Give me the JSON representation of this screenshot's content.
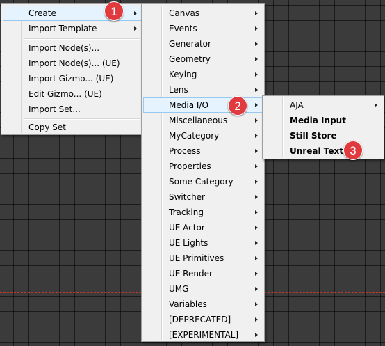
{
  "context_menu": {
    "items": [
      {
        "label": "Create"
      },
      {
        "label": "Import Template"
      },
      {
        "label": "Import Node(s)..."
      },
      {
        "label": "Import Node(s)... (UE)"
      },
      {
        "label": "Import Gizmo... (UE)"
      },
      {
        "label": "Edit Gizmo... (UE)"
      },
      {
        "label": "Import Set..."
      },
      {
        "label": "Copy Set"
      }
    ]
  },
  "create_submenu": {
    "items": [
      {
        "label": "Canvas"
      },
      {
        "label": "Events"
      },
      {
        "label": "Generator"
      },
      {
        "label": "Geometry"
      },
      {
        "label": "Keying"
      },
      {
        "label": "Lens"
      },
      {
        "label": "Media I/O"
      },
      {
        "label": "Miscellaneous"
      },
      {
        "label": "MyCategory"
      },
      {
        "label": "Process"
      },
      {
        "label": "Properties"
      },
      {
        "label": "Some Category"
      },
      {
        "label": "Switcher"
      },
      {
        "label": "Tracking"
      },
      {
        "label": "UE Actor"
      },
      {
        "label": "UE Lights"
      },
      {
        "label": "UE Primitives"
      },
      {
        "label": "UE Render"
      },
      {
        "label": "UMG"
      },
      {
        "label": "Variables"
      },
      {
        "label": "[DEPRECATED]"
      },
      {
        "label": "[EXPERIMENTAL]"
      }
    ]
  },
  "media_io_submenu": {
    "items": [
      {
        "label": "AJA"
      },
      {
        "label": "Media Input"
      },
      {
        "label": "Still Store"
      },
      {
        "label": "Unreal Texture"
      }
    ]
  },
  "badges": {
    "step1": "1",
    "step2": "2",
    "step3": "3"
  },
  "colors": {
    "highlight_bg": "#e5f3ff",
    "highlight_border": "#99c9ef",
    "badge": "#e0393e",
    "canvas": "#3b3b3b"
  }
}
